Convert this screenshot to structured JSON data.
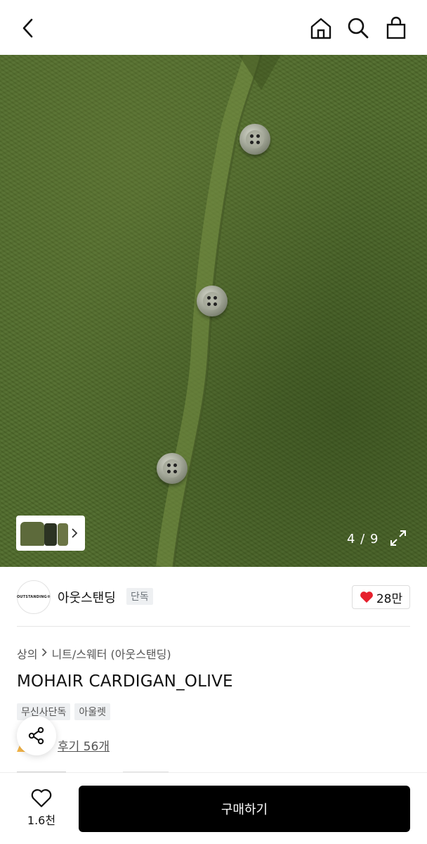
{
  "nav": {
    "back_icon": "chevron-left-icon",
    "home_icon": "home-icon",
    "search_icon": "search-icon",
    "bag_icon": "shopping-bag-icon"
  },
  "gallery": {
    "counter": "4 / 9",
    "color": "#4f6a2a"
  },
  "store": {
    "logo_text": "OUTSTANDING®",
    "name": "아웃스탠딩",
    "badge": "단독",
    "like_count": "28만"
  },
  "breadcrumb": {
    "category": "상의",
    "subcategory": "니트/스웨터 (아웃스탠딩)"
  },
  "product": {
    "title": "MOHAIR CARDIGAN_OLIVE",
    "tags": [
      "무신사단독",
      "아울렛"
    ],
    "review_link": "후기 56개"
  },
  "bottom": {
    "wish_count": "1.6천",
    "buy_label": "구매하기",
    "accent": "#000000",
    "heart_color": "#e6202d"
  }
}
